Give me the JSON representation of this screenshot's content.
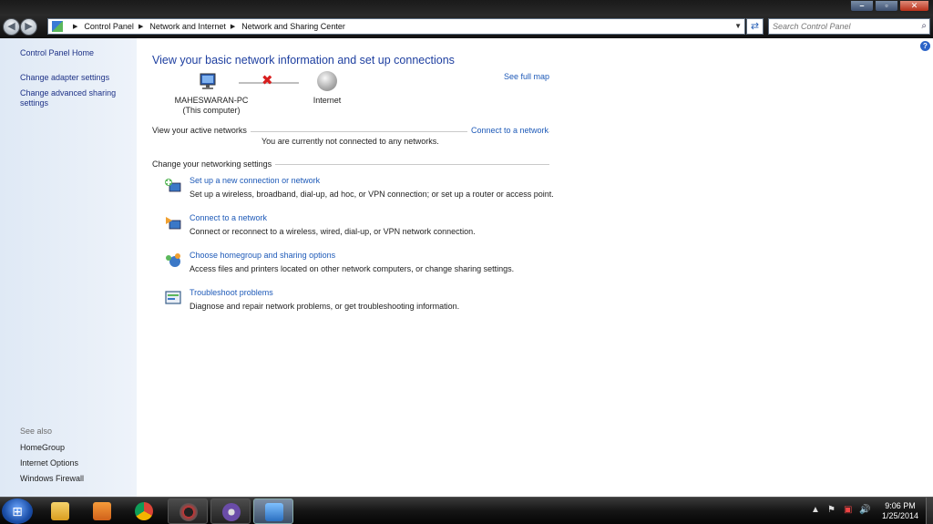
{
  "address": {
    "crumbs": [
      "Control Panel",
      "Network and Internet",
      "Network and Sharing Center"
    ],
    "search_placeholder": "Search Control Panel"
  },
  "sidebar": {
    "home": "Control Panel Home",
    "links": [
      "Change adapter settings",
      "Change advanced sharing settings"
    ],
    "see_also": "See also",
    "see_also_links": [
      "HomeGroup",
      "Internet Options",
      "Windows Firewall"
    ]
  },
  "main": {
    "heading": "View your basic network information and set up connections",
    "see_full_map": "See full map",
    "computer_name": "MAHESWARAN-PC",
    "computer_sub": "(This computer)",
    "internet": "Internet",
    "active_networks_label": "View your active networks",
    "connect_link": "Connect to a network",
    "not_connected": "You are currently not connected to any networks.",
    "change_settings_label": "Change your networking settings",
    "tasks": [
      {
        "title": "Set up a new connection or network",
        "desc": "Set up a wireless, broadband, dial-up, ad hoc, or VPN connection; or set up a router or access point."
      },
      {
        "title": "Connect to a network",
        "desc": "Connect or reconnect to a wireless, wired, dial-up, or VPN network connection."
      },
      {
        "title": "Choose homegroup and sharing options",
        "desc": "Access files and printers located on other network computers, or change sharing settings."
      },
      {
        "title": "Troubleshoot problems",
        "desc": "Diagnose and repair network problems, or get troubleshooting information."
      }
    ]
  },
  "taskbar": {
    "time": "9:06 PM",
    "date": "1/25/2014",
    "icons": [
      "windows-explorer",
      "media-player",
      "chrome",
      "media-app",
      "torrent-app",
      "control-panel"
    ]
  },
  "colors": {
    "link": "#1e5ab8",
    "heading": "#1e3fa0",
    "sidebar_link": "#1e3287",
    "error_x": "#d81e1e"
  }
}
